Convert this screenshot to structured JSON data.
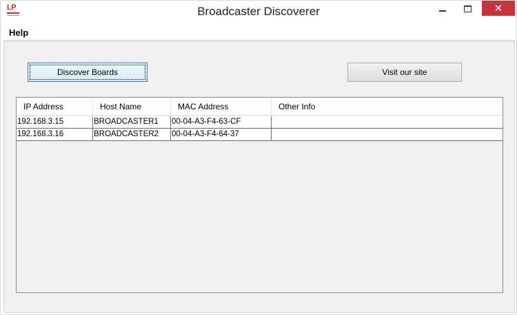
{
  "window": {
    "title": "Broadcaster Discoverer",
    "logo_text": "LP",
    "close_glyph": "✕",
    "close_color": "#c7333a"
  },
  "menu": {
    "items": [
      {
        "label": "Help"
      }
    ]
  },
  "buttons": {
    "discover": "Discover Boards",
    "visit": "Visit our site"
  },
  "table": {
    "columns": [
      "IP Address",
      "Host Name",
      "MAC Address",
      "Other Info"
    ],
    "rows": [
      {
        "ip": "192.168.3.15",
        "host": "BROADCASTER1",
        "mac": "00-04-A3-F4-63-CF",
        "info": ""
      },
      {
        "ip": "192.168.3.16",
        "host": "BROADCASTER2",
        "mac": "00-04-A3-F4-64-37",
        "info": ""
      }
    ]
  },
  "icons": [
    "app-logo",
    "minimize-icon",
    "maximize-icon",
    "close-icon"
  ]
}
